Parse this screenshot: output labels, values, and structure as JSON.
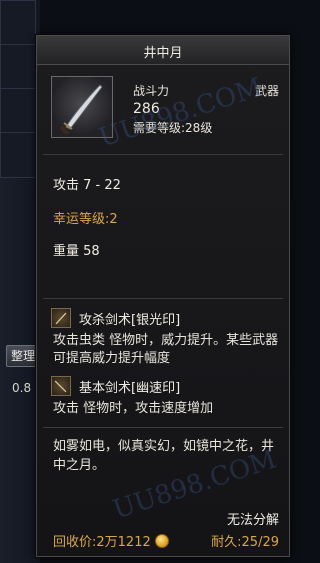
{
  "tooltip": {
    "title": "井中月",
    "power_label": "战斗力",
    "type_label": "武器",
    "power_value": "286",
    "required_level": "需要等级:28级",
    "attack": "攻击 7 - 22",
    "luck": "幸运等级:2",
    "weight": "重量 58",
    "skills": [
      {
        "name": "攻杀剑术[银光印]",
        "icon": "sword-skill-icon",
        "desc": "攻击虫类 怪物时，威力提升。某些武器可提高威力提升幅度"
      },
      {
        "name": "基本剑术[幽速印]",
        "icon": "sword-skill-icon",
        "desc": "攻击 怪物时，攻击速度增加"
      }
    ],
    "flavor": "如雾如电，似真实幻，如镜中之花，井中之月。",
    "no_decompose": "无法分解",
    "price": "回收价:2万1212",
    "durability": "耐久:25/29"
  },
  "background": {
    "side_button": "整理",
    "side_number": "0.8"
  },
  "watermark": "UU898.COM",
  "colors": {
    "gold_text": "#d9a64a",
    "panel_bg": "#1a1a1c",
    "border": "#4b4a4a"
  }
}
